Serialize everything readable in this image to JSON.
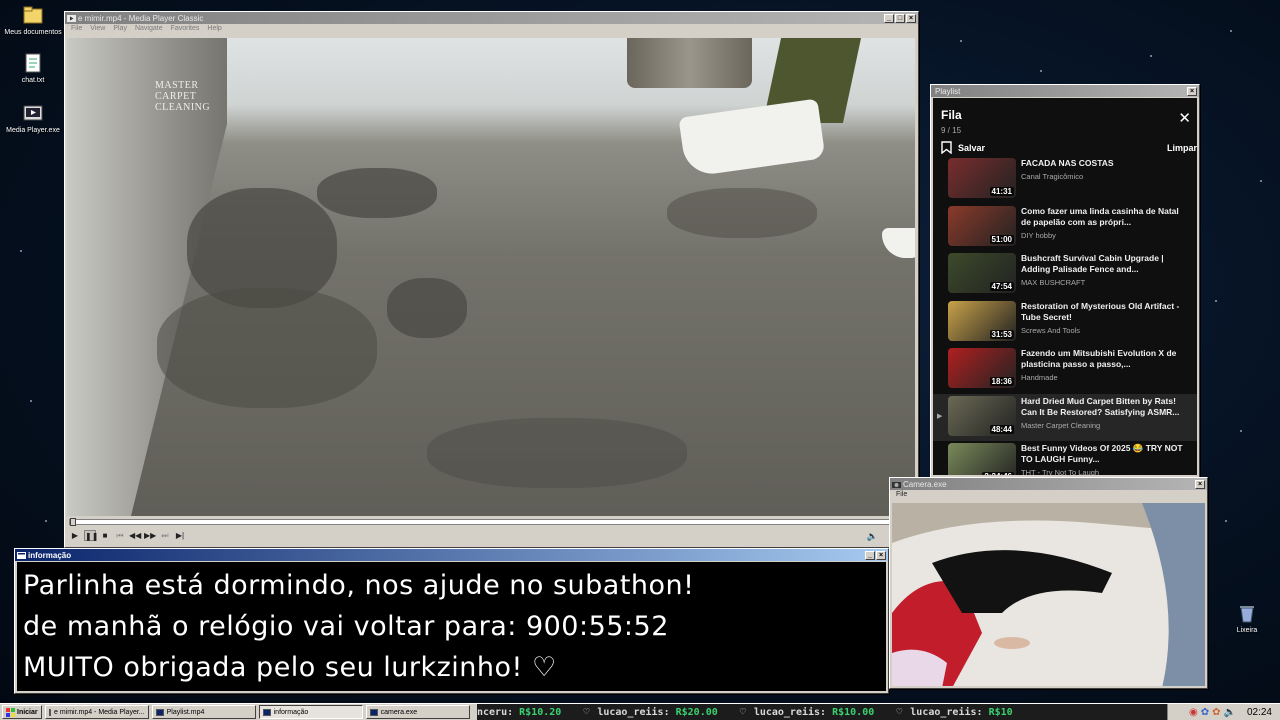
{
  "desktop": {
    "icons": [
      {
        "label": "Meus documentos",
        "icon": "folder-icon"
      },
      {
        "label": "chat.txt",
        "icon": "text-file-icon"
      },
      {
        "label": "Media Player.exe",
        "icon": "media-player-icon"
      }
    ],
    "recycle_label": "Lixeira"
  },
  "media_player": {
    "title": "e mimir.mp4 - Media Player Classic",
    "menu": [
      "File",
      "View",
      "Play",
      "Navigate",
      "Favorites",
      "Help"
    ],
    "logo_lines": [
      "MASTER",
      "CARPET",
      "CLEANING"
    ]
  },
  "playlist_window": {
    "title": "Playlist",
    "header": "Fila",
    "count": "9 / 15",
    "save_label": "Salvar",
    "clear_label": "Limpar",
    "items": [
      {
        "title": "FACADA NAS COSTAS",
        "channel": "Canal Tragicômico",
        "duration": "41:31",
        "color": "#7a2d2d"
      },
      {
        "title": "Como fazer uma linda casinha de Natal de papelão com as própri...",
        "channel": "DIY hobby",
        "duration": "51:00",
        "color": "#8a3a2a"
      },
      {
        "title": "Bushcraft Survival Cabin Upgrade | Adding Palisade Fence and...",
        "channel": "MAX BUSHCRAFT",
        "duration": "47:54",
        "color": "#3d4a2a"
      },
      {
        "title": "Restoration of Mysterious Old Artifact - Tube Secret!",
        "channel": "Screws And Tools",
        "duration": "31:53",
        "color": "#c9a24a"
      },
      {
        "title": "Fazendo um Mitsubishi Evolution X de plasticina passo a passo,...",
        "channel": "Handmade",
        "duration": "18:36",
        "color": "#b02020"
      },
      {
        "title": "Hard Dried Mud Carpet Bitten by Rats! Can It Be Restored? Satisfying ASMR...",
        "channel": "Master Carpet Cleaning",
        "duration": "48:44",
        "color": "#6b6a55",
        "current": true
      },
      {
        "title": "Best Funny Videos Of 2025 😂 TRY NOT TO LAUGH Funny...",
        "channel": "THT - Try Not To Laugh",
        "duration": "2:24:46",
        "color": "#7a8a5a"
      }
    ]
  },
  "info_window": {
    "title": "informação",
    "lines": [
      "Parlinha está dormindo, nos ajude no subathon!",
      "de manhã o relógio vai voltar para:  900:55:52",
      "MUITO obrigada pelo seu lurkzinho! ♡"
    ]
  },
  "camera_window": {
    "title": "Camera.exe",
    "menu": [
      "File"
    ]
  },
  "taskbar": {
    "start_label": "Iniciar",
    "tasks": [
      {
        "label": "e mimir.mp4 - Media Player...",
        "pressed": false
      },
      {
        "label": "Playlist.mp4",
        "pressed": false
      },
      {
        "label": "informação",
        "pressed": true
      },
      {
        "label": "camera.exe",
        "pressed": false
      }
    ],
    "ticker": [
      {
        "name": "nceru:",
        "amount": "R$10.20"
      },
      {
        "name": "lucao_reiis:",
        "amount": "R$20.00"
      },
      {
        "name": "lucao_reiis:",
        "amount": "R$10.00"
      },
      {
        "name": "lucao_reiis:",
        "amount": "R$10"
      }
    ],
    "clock": "02:24"
  }
}
